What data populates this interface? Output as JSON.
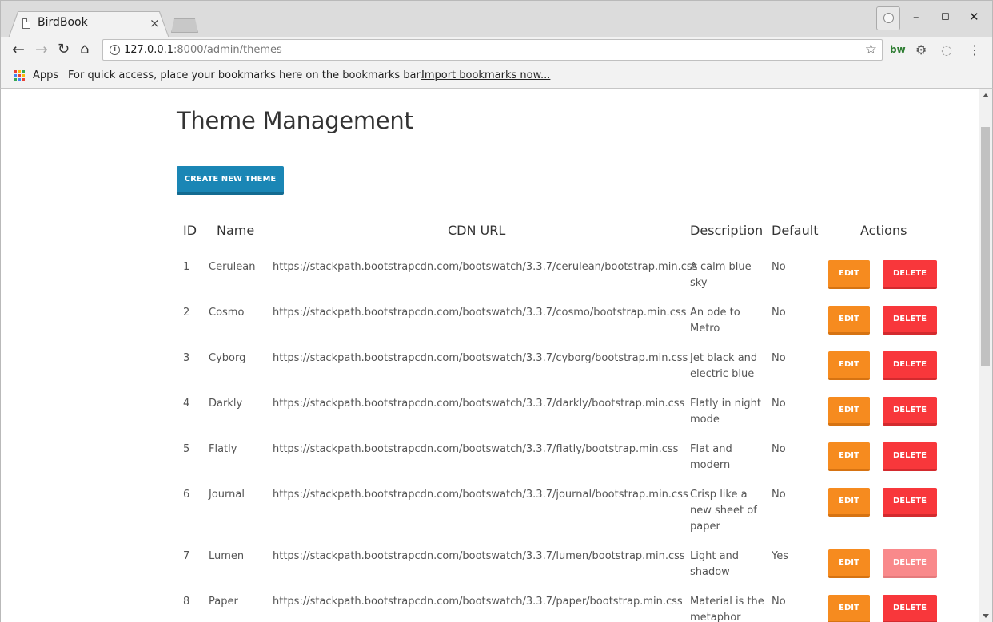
{
  "browser": {
    "tab_title": "BirdBook",
    "tab_close": "×",
    "url_host": "127.0.0.1",
    "url_rest": ":8000/admin/themes",
    "bookmarks": {
      "apps_label": "Apps",
      "hint": "For quick access, place your bookmarks here on the bookmarks bar.",
      "import_link": "Import bookmarks now..."
    }
  },
  "page": {
    "title": "Theme Management",
    "create_button": "CREATE NEW THEME",
    "columns": {
      "id": "ID",
      "name": "Name",
      "cdn": "CDN URL",
      "description": "Description",
      "default": "Default",
      "actions": "Actions"
    },
    "edit_label": "EDIT",
    "delete_label": "DELETE",
    "rows": [
      {
        "id": "1",
        "name": "Cerulean",
        "cdn": "https://stackpath.bootstrapcdn.com/bootswatch/3.3.7/cerulean/bootstrap.min.css",
        "description": "A calm blue sky",
        "default": "No"
      },
      {
        "id": "2",
        "name": "Cosmo",
        "cdn": "https://stackpath.bootstrapcdn.com/bootswatch/3.3.7/cosmo/bootstrap.min.css",
        "description": "An ode to Metro",
        "default": "No"
      },
      {
        "id": "3",
        "name": "Cyborg",
        "cdn": "https://stackpath.bootstrapcdn.com/bootswatch/3.3.7/cyborg/bootstrap.min.css",
        "description": "Jet black and electric blue",
        "default": "No"
      },
      {
        "id": "4",
        "name": "Darkly",
        "cdn": "https://stackpath.bootstrapcdn.com/bootswatch/3.3.7/darkly/bootstrap.min.css",
        "description": "Flatly in night mode",
        "default": "No"
      },
      {
        "id": "5",
        "name": "Flatly",
        "cdn": "https://stackpath.bootstrapcdn.com/bootswatch/3.3.7/flatly/bootstrap.min.css",
        "description": "Flat and modern",
        "default": "No"
      },
      {
        "id": "6",
        "name": "Journal",
        "cdn": "https://stackpath.bootstrapcdn.com/bootswatch/3.3.7/journal/bootstrap.min.css",
        "description": "Crisp like a new sheet of paper",
        "default": "No"
      },
      {
        "id": "7",
        "name": "Lumen",
        "cdn": "https://stackpath.bootstrapcdn.com/bootswatch/3.3.7/lumen/bootstrap.min.css",
        "description": "Light and shadow",
        "default": "Yes"
      },
      {
        "id": "8",
        "name": "Paper",
        "cdn": "https://stackpath.bootstrapcdn.com/bootswatch/3.3.7/paper/bootstrap.min.css",
        "description": "Material is the metaphor",
        "default": "No"
      }
    ]
  },
  "colors": {
    "primary": "#1a86b5",
    "edit": "#f68b1f",
    "delete": "#f8373b",
    "delete_disabled": "#f9898b"
  }
}
